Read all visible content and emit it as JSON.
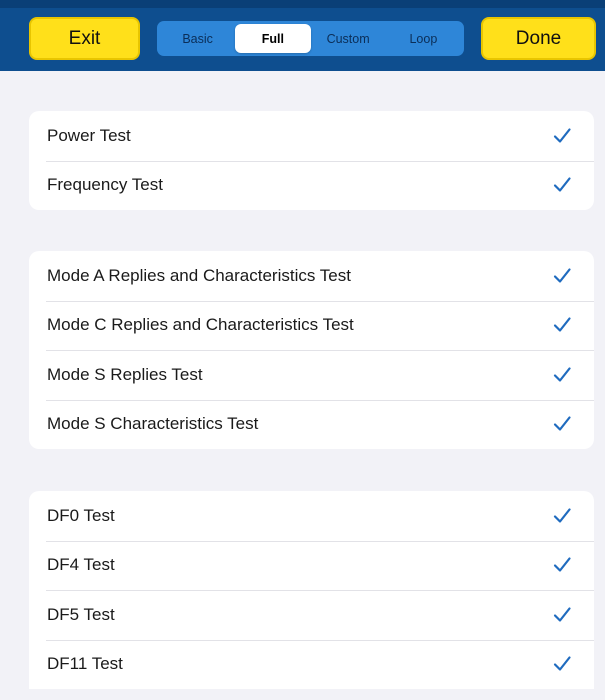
{
  "header": {
    "exit_label": "Exit",
    "done_label": "Done",
    "segments": [
      {
        "label": "Basic",
        "selected": false
      },
      {
        "label": "Full",
        "selected": true
      },
      {
        "label": "Custom",
        "selected": false
      },
      {
        "label": "Loop",
        "selected": false
      }
    ]
  },
  "groups": [
    {
      "items": [
        {
          "label": "Power Test",
          "checked": true
        },
        {
          "label": "Frequency Test",
          "checked": true
        }
      ]
    },
    {
      "items": [
        {
          "label": "Mode A Replies and Characteristics Test",
          "checked": true
        },
        {
          "label": "Mode C Replies and Characteristics Test",
          "checked": true
        },
        {
          "label": "Mode S Replies Test",
          "checked": true
        },
        {
          "label": "Mode S Characteristics Test",
          "checked": true
        }
      ]
    },
    {
      "items": [
        {
          "label": "DF0 Test",
          "checked": true
        },
        {
          "label": "DF4 Test",
          "checked": true
        },
        {
          "label": "DF5 Test",
          "checked": true
        },
        {
          "label": "DF11 Test",
          "checked": true
        }
      ]
    }
  ],
  "colors": {
    "header_bg": "#0e4e8f",
    "button_yellow": "#ffe01a",
    "segment_bg": "#2e86d8",
    "check_color": "#1f6bbf",
    "page_bg": "#f2f2f7"
  },
  "icons": {
    "check": "checkmark-icon"
  }
}
